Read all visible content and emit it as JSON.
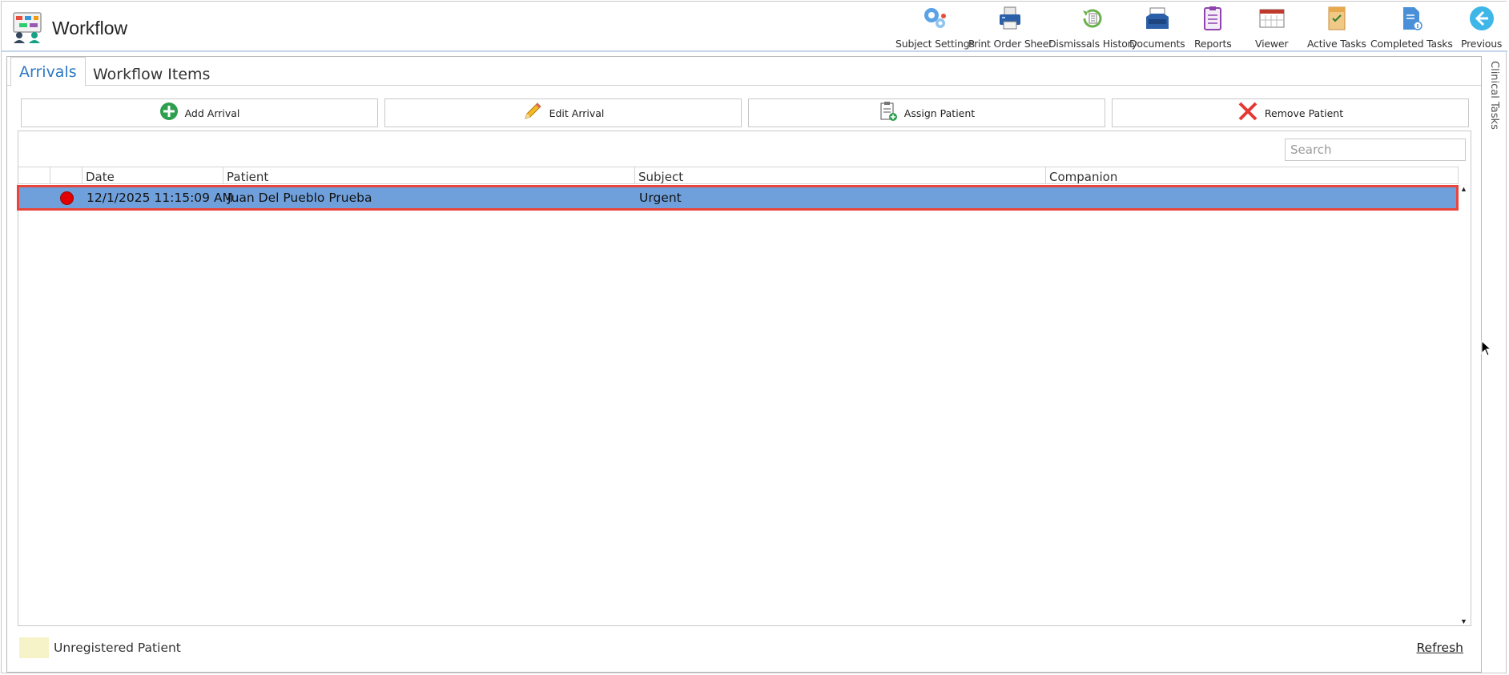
{
  "app": {
    "title": "Workflow"
  },
  "toolbar": {
    "items": [
      {
        "label": "Subject Settings",
        "icon": "gears-icon"
      },
      {
        "label": "Print Order Sheet",
        "icon": "printer-icon"
      },
      {
        "label": "Dismissals History",
        "icon": "history-icon"
      },
      {
        "label": "Documents",
        "icon": "inbox-tray-icon"
      },
      {
        "label": "Reports",
        "icon": "clipboard-icon"
      },
      {
        "label": "Viewer",
        "icon": "calendar-viewer-icon"
      },
      {
        "label": "Active Tasks",
        "icon": "task-box-icon"
      },
      {
        "label": "Completed Tasks",
        "icon": "document-info-icon"
      },
      {
        "label": "Previous",
        "icon": "back-arrow-icon"
      }
    ]
  },
  "tabs": [
    {
      "label": "Arrivals",
      "active": true
    },
    {
      "label": "Workflow Items",
      "active": false
    }
  ],
  "actions": {
    "add_arrival": "Add Arrival",
    "edit_arrival": "Edit Arrival",
    "assign_patient": "Assign Patient",
    "remove_patient": "Remove Patient"
  },
  "search": {
    "placeholder": "Search",
    "value": ""
  },
  "grid": {
    "columns": [
      "",
      "",
      "Date",
      "Patient",
      "Subject",
      "Companion"
    ],
    "rows": [
      {
        "status_color": "#e30000",
        "date": "12/1/2025 11:15:09 AM",
        "patient": "Juan Del Pueblo Prueba",
        "subject": "Urgent",
        "companion": "",
        "selected": true
      }
    ]
  },
  "legend": {
    "label": "Unregistered Patient",
    "color": "#f5f3c7"
  },
  "footer": {
    "refresh_label": "Refresh"
  },
  "side_panel": {
    "label": "Clinical Tasks"
  },
  "colors": {
    "accent": "#2a78c4",
    "selection": "#6fa0dc",
    "selection_border": "#e8453c"
  }
}
